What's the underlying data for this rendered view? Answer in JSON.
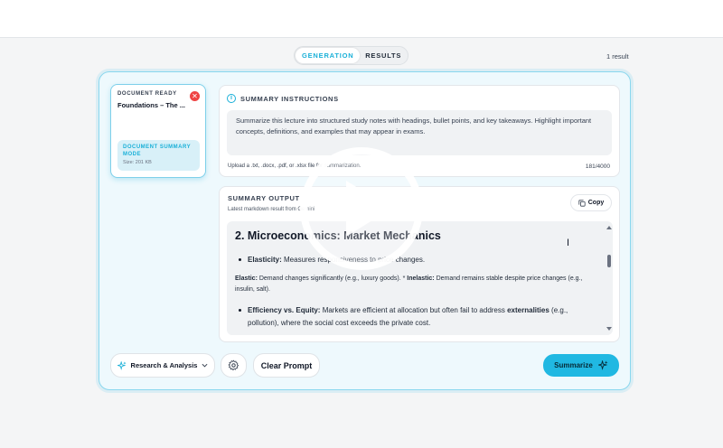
{
  "colors": {
    "accent": "#1ab0d8",
    "panel_border": "#8ad7ee",
    "close_red": "#ef4444",
    "summarize_bg": "#20b8e2"
  },
  "view_toggle": {
    "generation_label": "GENERATION",
    "results_label": "RESULTS",
    "active": "GENERATION"
  },
  "result_count": "1 result",
  "document": {
    "status": "DOCUMENT READY",
    "title": "Foundations – The ...",
    "mode_label": "DOCUMENT SUMMARY MODE",
    "size": "Size: 201 KB",
    "close_icon": "close-icon"
  },
  "instructions": {
    "heading": "SUMMARY INSTRUCTIONS",
    "icon": "info-icon",
    "text": "Summarize this lecture into structured study notes with headings, bullet points, and key takeaways. Highlight important concepts, definitions, and examples that may appear in exams.",
    "upload_hint": "Upload a .txt, .docx, .pdf, or .xlsx file for summarization.",
    "char_count": "181/4000"
  },
  "output": {
    "heading": "SUMMARY OUTPUT",
    "subtitle": "Latest markdown result from Gemini",
    "copy_label": "Copy",
    "copy_icon": "copy-icon",
    "h2": "2. Microeconomics: Market Mechanics",
    "bullet1_bold": "Elasticity:",
    "bullet1_text": " Measures responsiveness to price changes.",
    "para_bold1": "Elastic:",
    "para_text1": " Demand changes significantly (e.g., luxury goods). * ",
    "para_bold2": "Inelastic:",
    "para_text2": " Demand remains stable despite price changes (e.g., insulin, salt).",
    "bullet2_bold": "Efficiency vs. Equity:",
    "bullet2_text": " Markets are efficient at allocation but often fail to address ",
    "bullet2_bold2": "externalities",
    "bullet2_text2": " (e.g., pollution), where the social cost exceeds the private cost."
  },
  "toolbar": {
    "mode_label": "Research & Analysis",
    "mode_icon": "sparkle-icon",
    "settings_icon": "gear-icon",
    "clear_label": "Clear Prompt",
    "summarize_label": "Summarize",
    "summarize_icon": "sparkle-icon"
  },
  "overlay": {
    "icon": "play-icon"
  }
}
